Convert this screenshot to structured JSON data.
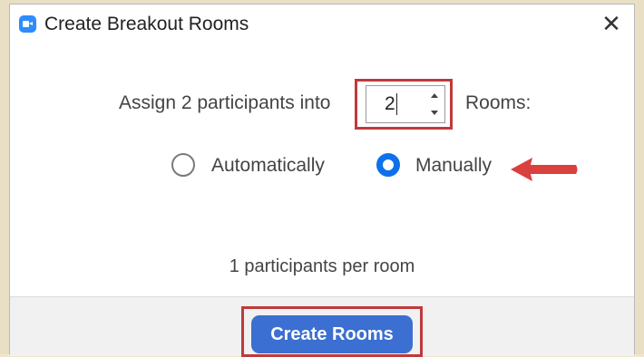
{
  "window": {
    "title": "Create Breakout Rooms",
    "app_icon": "zoom-camera-icon",
    "close_glyph": "✕"
  },
  "assign": {
    "prefix_label": "Assign 2 participants into",
    "room_count_value": "2",
    "suffix_label": "Rooms:"
  },
  "assignment_mode": {
    "options": [
      {
        "label": "Automatically",
        "selected": false
      },
      {
        "label": "Manually",
        "selected": true
      }
    ]
  },
  "summary": {
    "per_room_text": "1 participants per room"
  },
  "footer": {
    "create_button_label": "Create Rooms"
  },
  "colors": {
    "accent_blue": "#0e71eb",
    "button_blue": "#3b6fd1",
    "annotation_red": "#c0393b",
    "arrow_red": "#d9403e",
    "app_icon_blue": "#2d8cff"
  }
}
